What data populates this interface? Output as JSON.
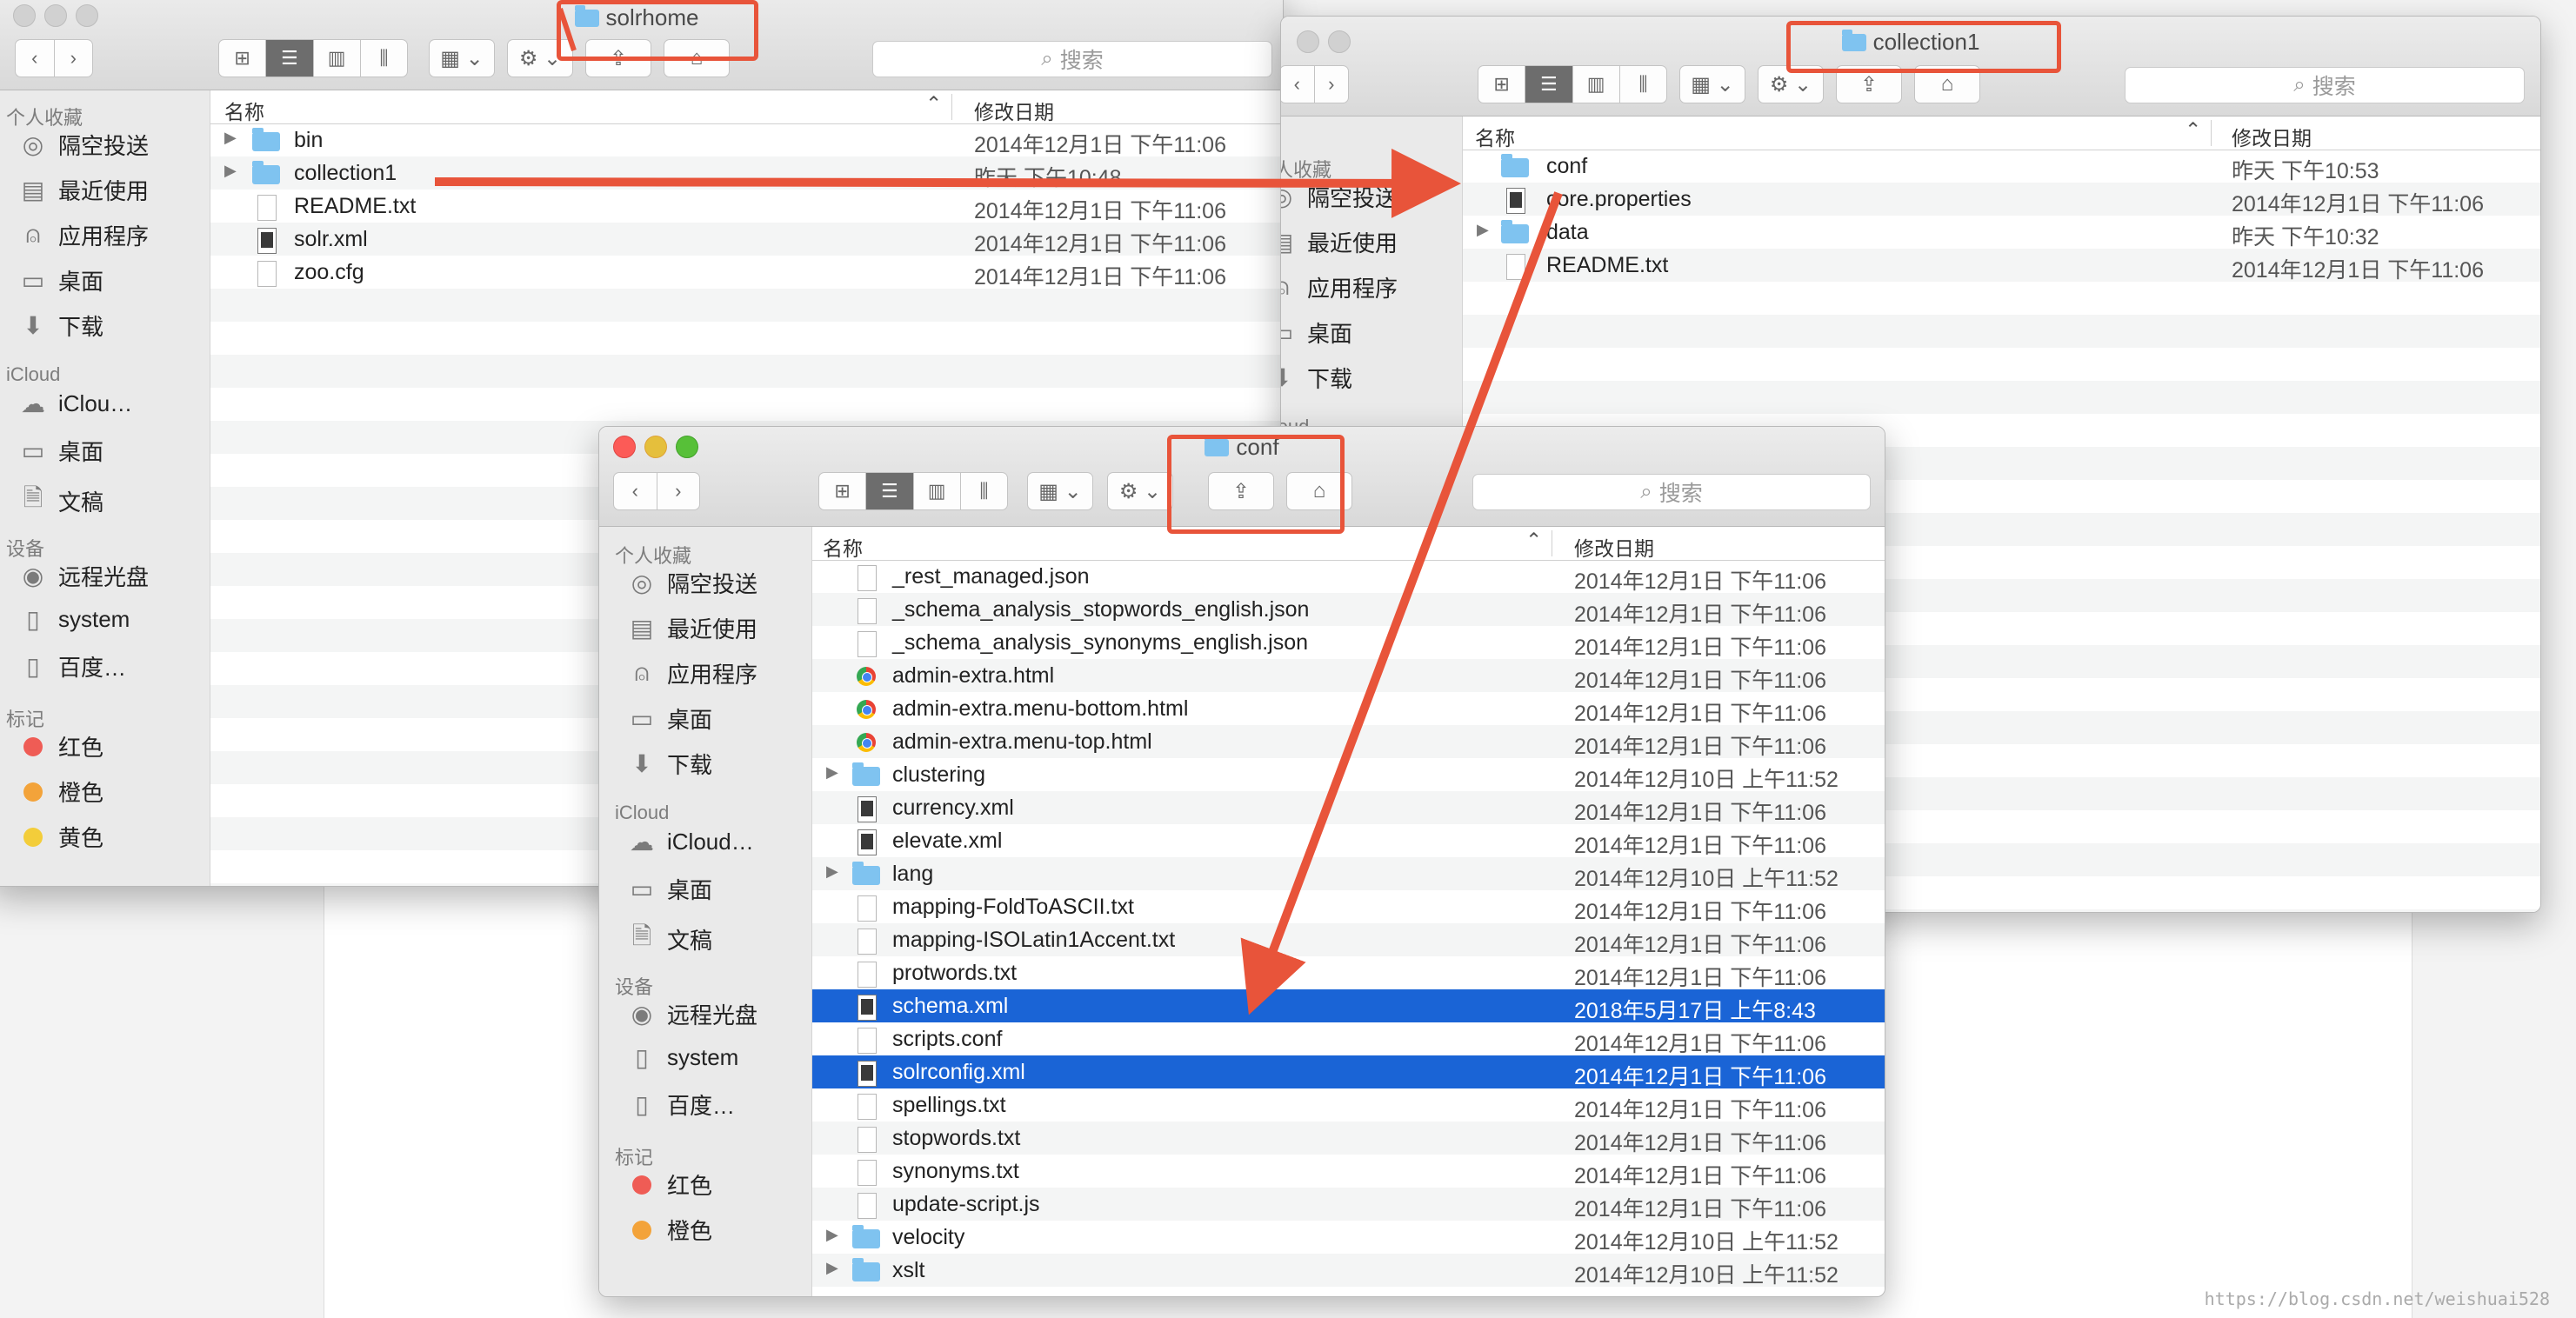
{
  "colors": {
    "accent": "#e8543a",
    "selection": "#1a64d6",
    "folder": "#7fc3f0"
  },
  "sidebar_icons": {
    "airdrop": "airdrop-icon",
    "recents": "recents-icon",
    "apps": "applications-icon",
    "desktop": "desktop-icon",
    "downloads": "downloads-icon",
    "icloud": "icloud-icon",
    "docs": "documents-icon",
    "disc": "disc-icon",
    "drive": "drive-icon"
  },
  "window_solrhome": {
    "title": "solrhome",
    "search_placeholder": "搜索",
    "columns": {
      "name": "名称",
      "date": "修改日期"
    },
    "sidebar": {
      "favorites_header": "个人收藏",
      "favorites": [
        "隔空投送",
        "最近使用",
        "应用程序",
        "桌面",
        "下载"
      ],
      "icloud_header": "iCloud",
      "icloud": [
        "iClou…",
        "桌面",
        "文稿"
      ],
      "devices_header": "设备",
      "devices": [
        "远程光盘",
        "system",
        "百度…"
      ],
      "tags_header": "标记",
      "tags": [
        "红色",
        "橙色",
        "黄色"
      ]
    },
    "files": [
      {
        "name": "bin",
        "date": "2014年12月1日 下午11:06",
        "kind": "folder",
        "expandable": true
      },
      {
        "name": "collection1",
        "date": "昨天 下午10:48",
        "kind": "folder",
        "expandable": true
      },
      {
        "name": "README.txt",
        "date": "2014年12月1日 下午11:06",
        "kind": "doc"
      },
      {
        "name": "solr.xml",
        "date": "2014年12月1日 下午11:06",
        "kind": "xml"
      },
      {
        "name": "zoo.cfg",
        "date": "2014年12月1日 下午11:06",
        "kind": "doc"
      }
    ]
  },
  "window_collection1": {
    "title": "collection1",
    "search_placeholder": "搜索",
    "columns": {
      "name": "名称",
      "date": "修改日期"
    },
    "sidebar": {
      "favorites_header": "个人收藏",
      "favorites": [
        "隔空投送",
        "最近使用",
        "应用程序",
        "桌面",
        "下载"
      ],
      "icloud_header": "iCloud"
    },
    "files": [
      {
        "name": "conf",
        "date": "昨天 下午10:53",
        "kind": "folder"
      },
      {
        "name": "core.properties",
        "date": "2014年12月1日 下午11:06",
        "kind": "xml"
      },
      {
        "name": "data",
        "date": "昨天 下午10:32",
        "kind": "folder",
        "expandable": true
      },
      {
        "name": "README.txt",
        "date": "2014年12月1日 下午11:06",
        "kind": "doc"
      }
    ]
  },
  "window_conf": {
    "title": "conf",
    "search_placeholder": "搜索",
    "columns": {
      "name": "名称",
      "date": "修改日期"
    },
    "sidebar": {
      "favorites_header": "个人收藏",
      "favorites": [
        "隔空投送",
        "最近使用",
        "应用程序",
        "桌面",
        "下载"
      ],
      "icloud_header": "iCloud",
      "icloud": [
        "iCloud…",
        "桌面",
        "文稿"
      ],
      "devices_header": "设备",
      "devices": [
        "远程光盘",
        "system",
        "百度…"
      ],
      "tags_header": "标记",
      "tags": [
        "红色",
        "橙色"
      ]
    },
    "files": [
      {
        "name": "_rest_managed.json",
        "date": "2014年12月1日 下午11:06",
        "kind": "doc"
      },
      {
        "name": "_schema_analysis_stopwords_english.json",
        "date": "2014年12月1日 下午11:06",
        "kind": "doc"
      },
      {
        "name": "_schema_analysis_synonyms_english.json",
        "date": "2014年12月1日 下午11:06",
        "kind": "doc"
      },
      {
        "name": "admin-extra.html",
        "date": "2014年12月1日 下午11:06",
        "kind": "html"
      },
      {
        "name": "admin-extra.menu-bottom.html",
        "date": "2014年12月1日 下午11:06",
        "kind": "html"
      },
      {
        "name": "admin-extra.menu-top.html",
        "date": "2014年12月1日 下午11:06",
        "kind": "html"
      },
      {
        "name": "clustering",
        "date": "2014年12月10日 上午11:52",
        "kind": "folder",
        "expandable": true
      },
      {
        "name": "currency.xml",
        "date": "2014年12月1日 下午11:06",
        "kind": "xml"
      },
      {
        "name": "elevate.xml",
        "date": "2014年12月1日 下午11:06",
        "kind": "xml"
      },
      {
        "name": "lang",
        "date": "2014年12月10日 上午11:52",
        "kind": "folder",
        "expandable": true
      },
      {
        "name": "mapping-FoldToASCII.txt",
        "date": "2014年12月1日 下午11:06",
        "kind": "doc"
      },
      {
        "name": "mapping-ISOLatin1Accent.txt",
        "date": "2014年12月1日 下午11:06",
        "kind": "doc"
      },
      {
        "name": "protwords.txt",
        "date": "2014年12月1日 下午11:06",
        "kind": "doc"
      },
      {
        "name": "schema.xml",
        "date": "2018年5月17日 上午8:43",
        "kind": "xml",
        "selected": true
      },
      {
        "name": "scripts.conf",
        "date": "2014年12月1日 下午11:06",
        "kind": "doc"
      },
      {
        "name": "solrconfig.xml",
        "date": "2014年12月1日 下午11:06",
        "kind": "xml",
        "selected": true
      },
      {
        "name": "spellings.txt",
        "date": "2014年12月1日 下午11:06",
        "kind": "doc"
      },
      {
        "name": "stopwords.txt",
        "date": "2014年12月1日 下午11:06",
        "kind": "doc"
      },
      {
        "name": "synonyms.txt",
        "date": "2014年12月1日 下午11:06",
        "kind": "doc"
      },
      {
        "name": "update-script.js",
        "date": "2014年12月1日 下午11:06",
        "kind": "doc"
      },
      {
        "name": "velocity",
        "date": "2014年12月10日 上午11:52",
        "kind": "folder",
        "expandable": true
      },
      {
        "name": "xslt",
        "date": "2014年12月10日 上午11:52",
        "kind": "folder",
        "expandable": true
      }
    ]
  },
  "watermark": "https://blog.csdn.net/weishuai528"
}
